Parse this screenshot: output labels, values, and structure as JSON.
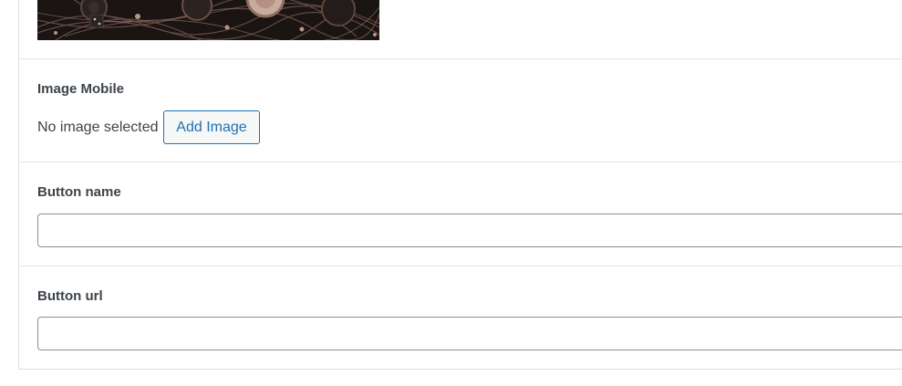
{
  "fields": {
    "image_mobile": {
      "label": "Image Mobile",
      "status_text": "No image selected",
      "add_button_label": "Add Image"
    },
    "button_name": {
      "label": "Button name",
      "value": ""
    },
    "button_url": {
      "label": "Button url",
      "value": ""
    }
  },
  "colors": {
    "accent": "#2271b1",
    "text": "#3c434a",
    "border": "#dcdcde",
    "input_border": "#8c8f94"
  }
}
